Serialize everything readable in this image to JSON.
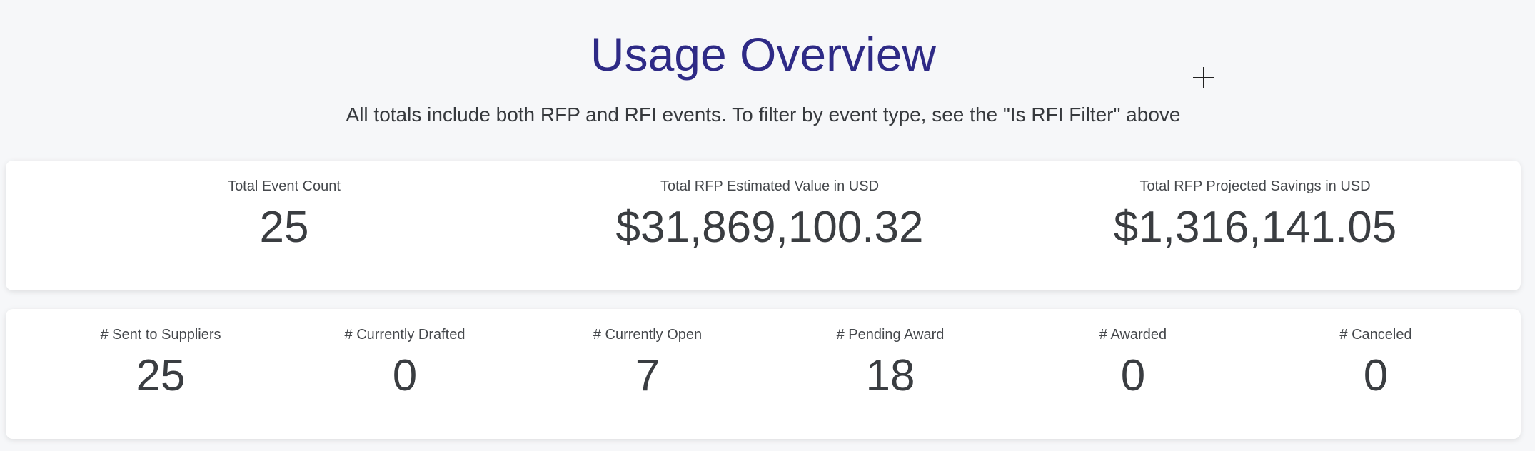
{
  "header": {
    "title": "Usage Overview",
    "subtitle": "All totals include both RFP and RFI events. To filter by event type, see the \"Is RFI Filter\" above"
  },
  "summary": {
    "total_event_count": {
      "label": "Total Event Count",
      "value": "25"
    },
    "total_estimated_value": {
      "label": "Total RFP Estimated Value in USD",
      "value": "$31,869,100.32"
    },
    "total_projected_savings": {
      "label": "Total RFP Projected Savings in USD",
      "value": "$1,316,141.05"
    }
  },
  "status_counts": {
    "sent": {
      "label": "# Sent to Suppliers",
      "value": "25"
    },
    "drafted": {
      "label": "# Currently Drafted",
      "value": "0"
    },
    "open": {
      "label": "# Currently Open",
      "value": "7"
    },
    "pending": {
      "label": "# Pending Award",
      "value": "18"
    },
    "awarded": {
      "label": "# Awarded",
      "value": "0"
    },
    "canceled": {
      "label": "# Canceled",
      "value": "0"
    }
  },
  "colors": {
    "title": "#2e2a86",
    "text": "#3a3d41",
    "background": "#f6f7f9",
    "card": "#ffffff"
  },
  "icons": {
    "cursor": "crosshair-cursor-icon"
  }
}
